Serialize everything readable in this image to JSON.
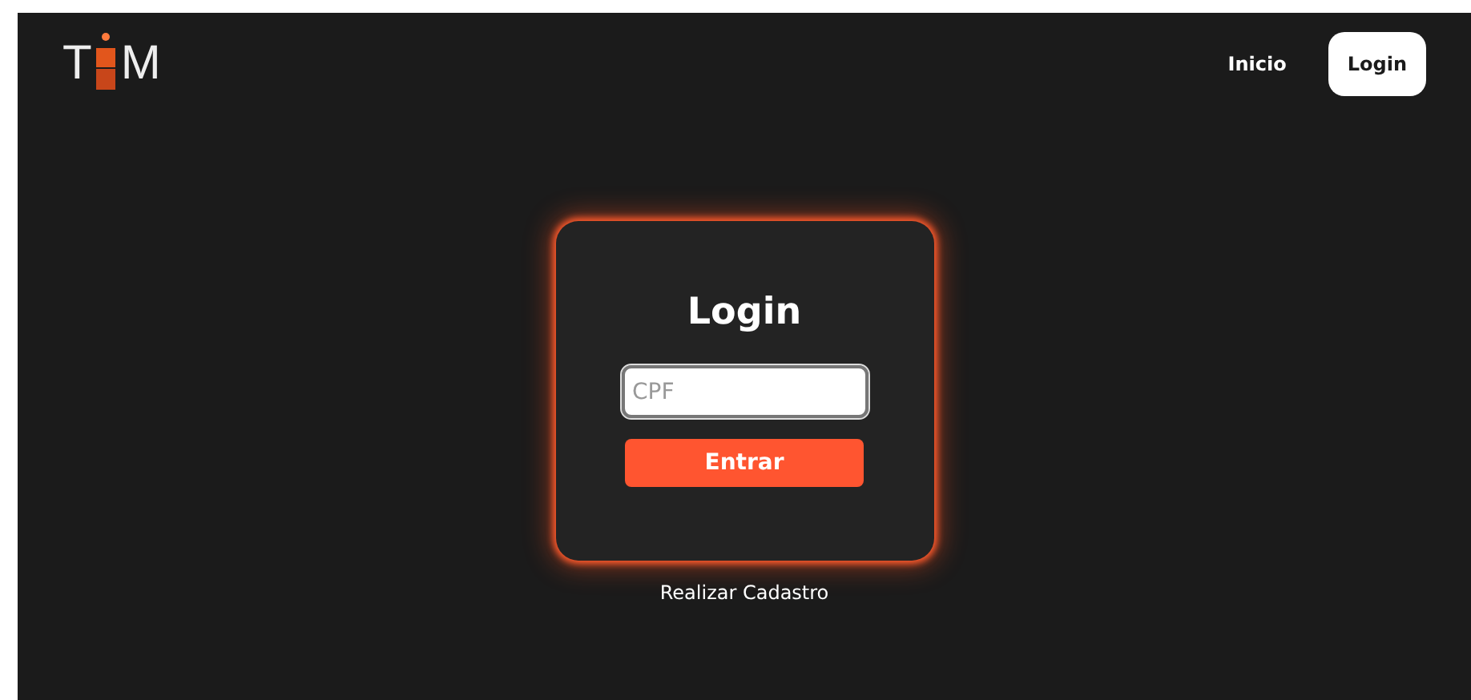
{
  "logo": {
    "left": "T",
    "right": "M"
  },
  "nav": [
    {
      "label": "Inicio",
      "selected": false
    },
    {
      "label": "Login",
      "selected": true
    }
  ],
  "card": {
    "title": "Login",
    "field": {
      "placeholder": "CPF"
    },
    "button": "Entrar"
  },
  "link": "Realizar Cadastro"
}
